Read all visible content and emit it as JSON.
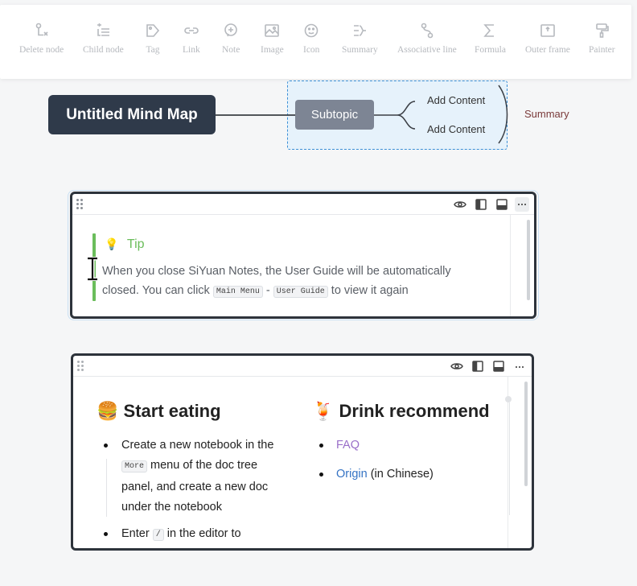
{
  "toolbar": {
    "items": [
      {
        "label": "Delete node",
        "icon": "delete-node-icon"
      },
      {
        "label": "Child node",
        "icon": "child-node-icon"
      },
      {
        "label": "Tag",
        "icon": "tag-icon"
      },
      {
        "label": "Link",
        "icon": "link-icon"
      },
      {
        "label": "Note",
        "icon": "note-icon"
      },
      {
        "label": "Image",
        "icon": "image-icon"
      },
      {
        "label": "Icon",
        "icon": "icon-icon"
      },
      {
        "label": "Summary",
        "icon": "summary-icon"
      },
      {
        "label": "Associative line",
        "icon": "associative-line-icon"
      },
      {
        "label": "Formula",
        "icon": "formula-icon"
      },
      {
        "label": "Outer frame",
        "icon": "outer-frame-icon"
      },
      {
        "label": "Painter",
        "icon": "painter-icon"
      }
    ]
  },
  "mindmap": {
    "root": "Untitled Mind Map",
    "subtopic": "Subtopic",
    "leaves": [
      "Add Content",
      "Add Content"
    ],
    "summary": "Summary"
  },
  "tip_block": {
    "emoji": "💡",
    "title": "Tip",
    "body_1": "When you close SiYuan Notes, the User Guide will be automatically closed. You can click ",
    "kbd_1": "Main Menu",
    "sep": " - ",
    "kbd_2": "User Guide",
    "body_2": " to view it again"
  },
  "doc_block": {
    "left_heading_emoji": "🍔",
    "left_heading": "Start eating",
    "left_item1_a": "Create a new notebook in the",
    "left_item1_kbd": "More",
    "left_item1_b": " menu of the doc tree",
    "left_item1_c": "panel, and create a new doc",
    "left_item1_d": "under the notebook",
    "left_item2_a": "Enter ",
    "left_item2_kbd": "/",
    "left_item2_b": " in the editor to",
    "right_heading_emoji": "🍹",
    "right_heading": "Drink recommend",
    "right_item1": "FAQ",
    "right_item2_link": "Origin",
    "right_item2_rest": " (in Chinese)"
  },
  "colors": {
    "root_bg": "#2f3a4a",
    "subtopic_bg": "#7d8594",
    "selection": "#3b8fd6",
    "tip_green": "#6bbd5b",
    "faq_link": "#9a6fc9",
    "origin_link": "#3573c4"
  }
}
